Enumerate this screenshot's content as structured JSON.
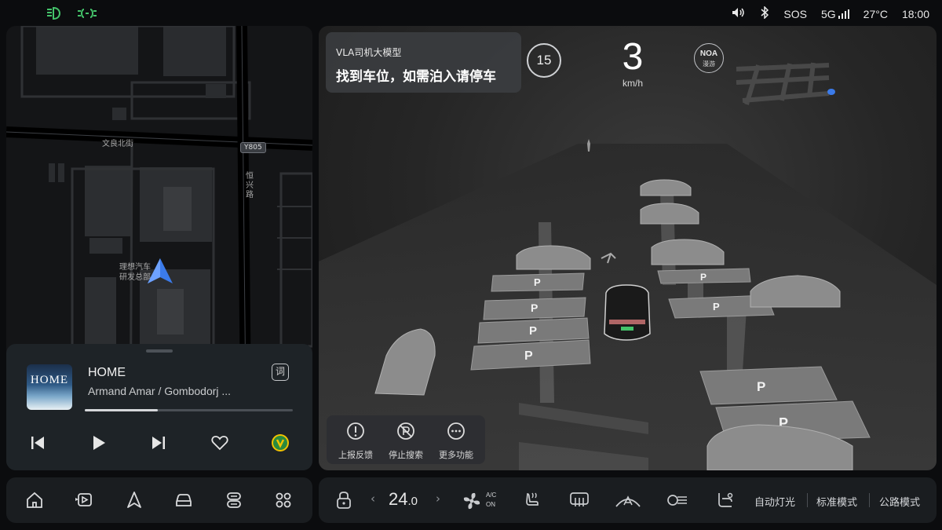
{
  "status_bar": {
    "left_icons": [
      "low-beam-icon",
      "parking-light-icon"
    ],
    "volume_icon": "volume-icon",
    "bluetooth_icon": "bluetooth-icon",
    "sos": "SOS",
    "network": "5G",
    "temperature": "27°C",
    "time": "18:00"
  },
  "map": {
    "labels": {
      "street_wenliang": "文良北街",
      "road_badge": "Y805",
      "street_hengxing": "恒兴路",
      "poi_line1": "理想汽车",
      "poi_line2": "研发总部"
    }
  },
  "media": {
    "album_text": "HOME",
    "title": "HOME",
    "artist": "Armand Amar / Gombodorj ...",
    "lyric_button": "词",
    "progress": 0.35
  },
  "left_dock": {
    "items": [
      "home-icon",
      "media-icon",
      "navigation-icon",
      "vehicle-icon",
      "controls-icon",
      "apps-icon"
    ]
  },
  "scene": {
    "vla_title": "VLA司机大模型",
    "vla_message": "找到车位，如需泊入请停车",
    "speed_limit": "15",
    "speed": "3",
    "speed_unit": "km/h",
    "noa_line1": "NOA",
    "noa_line2": "漫游",
    "parking_symbol": "P",
    "actions": [
      {
        "label": "上报反馈",
        "icon": "report-icon"
      },
      {
        "label": "停止搜索",
        "icon": "stop-search-icon"
      },
      {
        "label": "更多功能",
        "icon": "more-icon"
      }
    ]
  },
  "climate": {
    "temperature": "24",
    "temperature_decimal": ".0",
    "ac_line1": "A/C",
    "ac_line2": "ON",
    "mode_auto_lights": "自动灯光",
    "mode_standard": "标准模式",
    "mode_road": "公路模式"
  },
  "colors": {
    "accent_green": "#44c36a",
    "navigation_blue": "#3b7bea",
    "background": "#0b0c0e"
  }
}
